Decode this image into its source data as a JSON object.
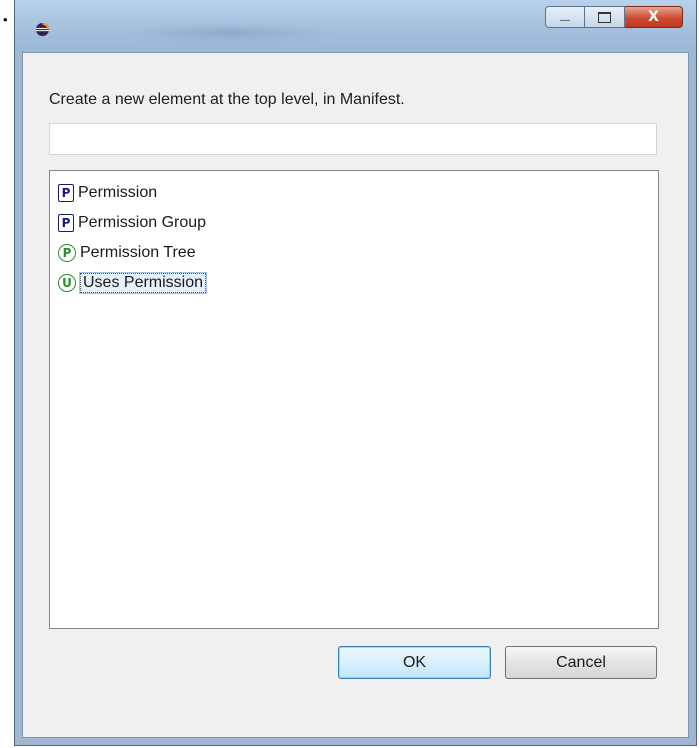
{
  "page": {
    "bullet": "•"
  },
  "window": {
    "title": "",
    "icon": "eclipse-icon",
    "caption_buttons": [
      "minimize-icon",
      "maximize-icon",
      "close-icon"
    ],
    "caption_glyphs": {
      "minimize": "—",
      "maximize": "▢",
      "close": "X"
    }
  },
  "dialog": {
    "prompt": "Create a new element at the top level, in Manifest.",
    "filter": {
      "value": "",
      "placeholder": ""
    },
    "items": [
      {
        "glyph": "P",
        "icon": "permission-icon",
        "label": "Permission",
        "selected": false
      },
      {
        "glyph": "P",
        "icon": "permission-group-icon",
        "label": "Permission Group",
        "selected": false
      },
      {
        "glyph": "P",
        "icon": "permission-tree-icon",
        "label": "Permission Tree",
        "selected": false
      },
      {
        "glyph": "U",
        "icon": "uses-permission-icon",
        "label": "Uses Permission",
        "selected": true
      }
    ],
    "ok_label": "OK",
    "cancel_label": "Cancel"
  },
  "colors": {
    "title_bar": "#a3bfdd",
    "close_button": "#c0391f",
    "selection": "#e5f0fb",
    "default_button_border": "#3c7fb1"
  }
}
